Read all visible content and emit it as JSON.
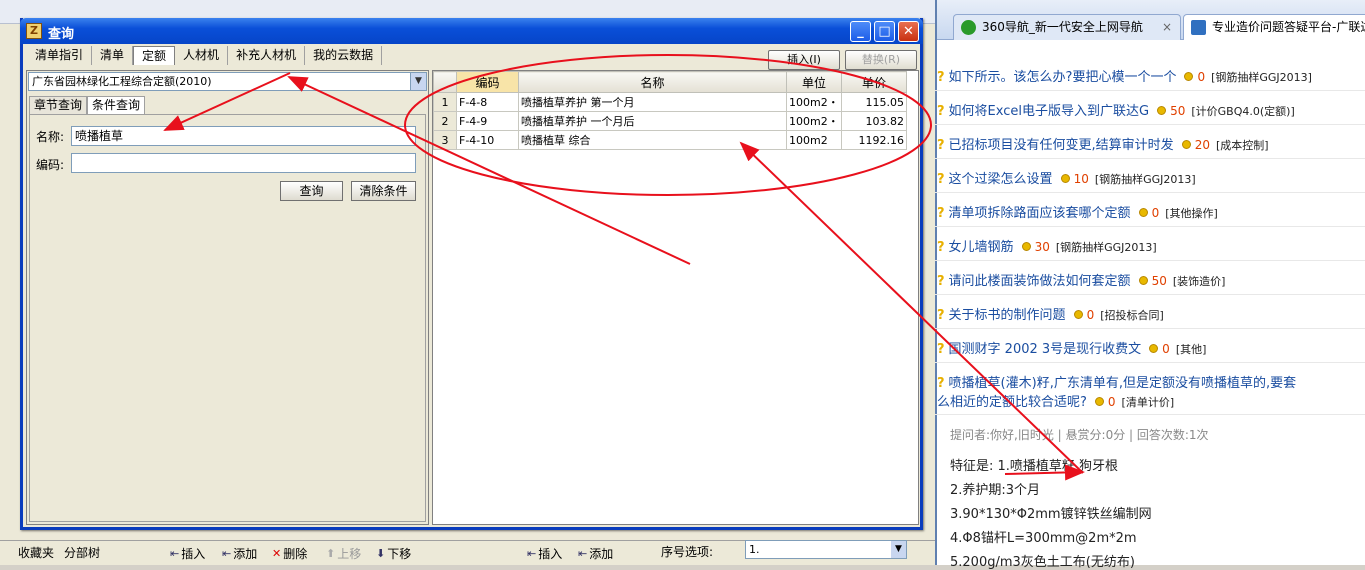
{
  "dialog": {
    "title": "查询",
    "tabs": [
      "清单指引",
      "清单",
      "定额",
      "人材机",
      "补充人材机",
      "我的云数据"
    ],
    "active_tab": "定额",
    "insert_label": "插入(I)",
    "replace_label": "替换(R)",
    "quota_library": "广东省园林绿化工程综合定额(2010)",
    "sub_tabs": [
      "章节查询",
      "条件查询"
    ],
    "form": {
      "name_label": "名称:",
      "name_value": "喷播植草",
      "code_label": "编码:",
      "code_value": "",
      "query_label": "查询",
      "clear_label": "清除条件"
    },
    "table": {
      "headers": [
        "编码",
        "名称",
        "单位",
        "单价"
      ],
      "rows": [
        {
          "n": "1",
          "code": "F-4-8",
          "name": "喷播植草养护 第一个月",
          "unit": "100m2・",
          "price": "115.05"
        },
        {
          "n": "2",
          "code": "F-4-9",
          "name": "喷播植草养护 一个月后",
          "unit": "100m2・",
          "price": "103.82"
        },
        {
          "n": "3",
          "code": "F-4-10",
          "name": "喷播植草 综合",
          "unit": "100m2",
          "price": "1192.16"
        }
      ]
    }
  },
  "bottom_bar": {
    "favorites": "收藏夹",
    "subsection": "分部树",
    "insert": "插入",
    "add": "添加",
    "delete": "删除",
    "up": "上移",
    "down": "下移",
    "insert2": "插入",
    "add2": "添加",
    "seq_label": "序号选项:",
    "seq_value": "1."
  },
  "browser": {
    "tabs": [
      "360导航_新一代安全上网导航",
      "专业造价问题答疑平台-广联达"
    ],
    "questions": [
      {
        "text": "如下所示。该怎么办?要把心模一个一个",
        "pts": "0",
        "cat": "[钢筋抽样GGJ2013]"
      },
      {
        "text": "如何将Excel电子版导入到广联达G",
        "pts": "50",
        "cat": "[计价GBQ4.0(定额)]"
      },
      {
        "text": "已招标项目没有任何变更,结算审计时发",
        "pts": "20",
        "cat": "[成本控制]"
      },
      {
        "text": "这个过梁怎么设置",
        "pts": "10",
        "cat": "[钢筋抽样GGJ2013]"
      },
      {
        "text": "清单项拆除路面应该套哪个定额",
        "pts": "0",
        "cat": "[其他操作]"
      },
      {
        "text": "女儿墙钢筋",
        "pts": "30",
        "cat": "[钢筋抽样GGJ2013]"
      },
      {
        "text": "请问此楼面装饰做法如何套定额",
        "pts": "50",
        "cat": "[装饰造价]"
      },
      {
        "text": "关于标书的制作问题",
        "pts": "0",
        "cat": "[招投标合同]"
      },
      {
        "text": "国测财字 2002 3号是现行收费文",
        "pts": "0",
        "cat": "[其他]"
      }
    ],
    "featured": {
      "line1": "喷播植草(灌木)籽,广东清单有,但是定额没有喷播植草的,要套",
      "line2": "么相近的定额比较合适呢?",
      "pts": "0",
      "cat": "[清单计价]"
    },
    "meta": "提问者:你好,旧时光  |  悬赏分:0分  |  回答次数:1次",
    "details": [
      "特征是: 1.喷播植草籽 狗牙根",
      "2.养护期:3个月",
      "3.90*130*Φ2mm镀锌铁丝编制网",
      "4.Φ8锚杆L=300mm@2m*2m",
      "5.200g/m3灰色土工布(无纺布)"
    ]
  }
}
